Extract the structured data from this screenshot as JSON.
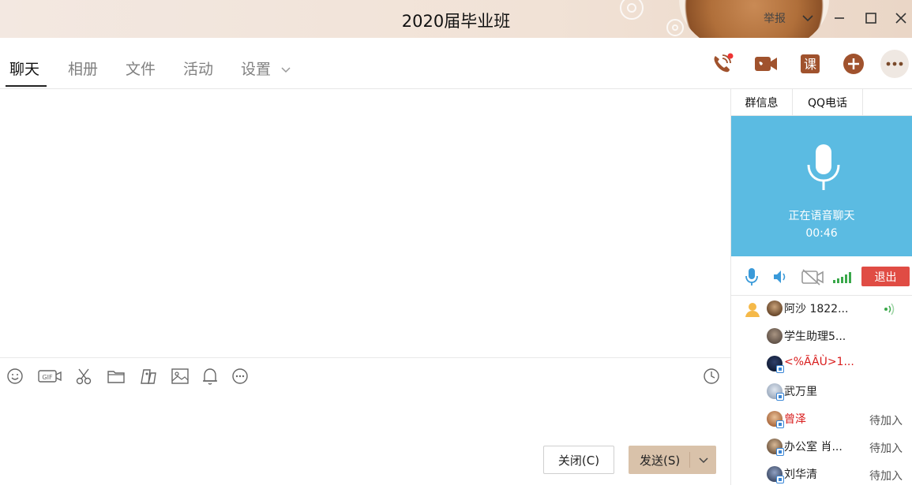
{
  "window": {
    "title": "2020届毕业班",
    "report_label": "举报"
  },
  "tabs": [
    {
      "label": "聊天",
      "active": true
    },
    {
      "label": "相册",
      "active": false
    },
    {
      "label": "文件",
      "active": false
    },
    {
      "label": "活动",
      "active": false
    },
    {
      "label": "设置",
      "active": false
    }
  ],
  "toolbar_icons": [
    "phone-call-icon",
    "video-call-icon",
    "course-icon",
    "add-icon",
    "more-icon"
  ],
  "toolbar_course_glyph": "课",
  "composer": {
    "tools": [
      "emoji-icon",
      "gif-icon",
      "scissors-icon",
      "folder-icon",
      "image-file-icon",
      "image-icon",
      "bell-icon",
      "more-circle-icon"
    ],
    "history_icon": "clock-icon",
    "close_label": "关闭(C)",
    "send_label": "发送(S)"
  },
  "side": {
    "tabs": [
      "群信息",
      "QQ电话"
    ],
    "voice_status": "正在语音聊天",
    "voice_time": "00:46",
    "exit_label": "退出",
    "members": [
      {
        "name": "阿沙 1822...",
        "status": "",
        "speaking": true,
        "red": false
      },
      {
        "name": "学生助理5...",
        "status": "",
        "speaking": false,
        "red": false
      },
      {
        "name": "<%ÃÂÙ>1...",
        "status": "",
        "speaking": false,
        "red": true
      },
      {
        "name": "武万里",
        "status": "",
        "speaking": false,
        "red": false
      },
      {
        "name": "曾泽",
        "status": "待加入",
        "speaking": false,
        "red": true
      },
      {
        "name": "办公室  肖...",
        "status": "待加入",
        "speaking": false,
        "red": false
      },
      {
        "name": "刘华清",
        "status": "待加入",
        "speaking": false,
        "red": false
      }
    ]
  },
  "colors": {
    "accent_brown": "#a0522d",
    "voice_panel": "#5bbbe2",
    "exit_red": "#e04c44",
    "send_button": "#d9c2aa",
    "member_red": "#d91c1c"
  }
}
